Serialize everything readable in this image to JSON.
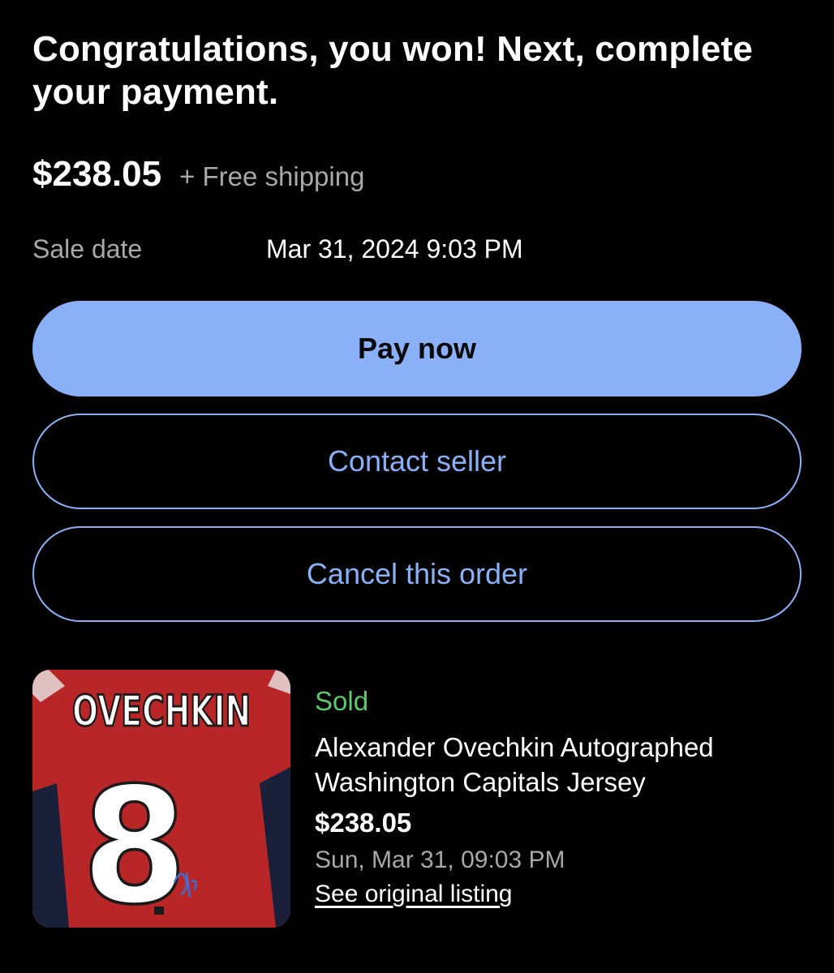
{
  "header": {
    "title": "Congratulations, you won! Next, complete your payment."
  },
  "summary": {
    "price": "$238.05",
    "shipping": "+ Free shipping",
    "sale_date_label": "Sale date",
    "sale_date_value": "Mar 31, 2024 9:03 PM"
  },
  "actions": {
    "pay_label": "Pay now",
    "contact_label": "Contact seller",
    "cancel_label": "Cancel this order"
  },
  "item": {
    "status": "Sold",
    "title": "Alexander Ovechkin Autographed Washington Capitals Jersey",
    "price": "$238.05",
    "date": "Sun, Mar 31, 09:03 PM",
    "link_label": "See original listing",
    "image": {
      "jersey_name": "OVECHKIN",
      "jersey_number": "8"
    }
  },
  "colors": {
    "background": "#000000",
    "accent": "#8ab0f8",
    "sold_green": "#5cc96a",
    "muted_text": "#a8a8a8",
    "jersey_red": "#c42a2a"
  }
}
